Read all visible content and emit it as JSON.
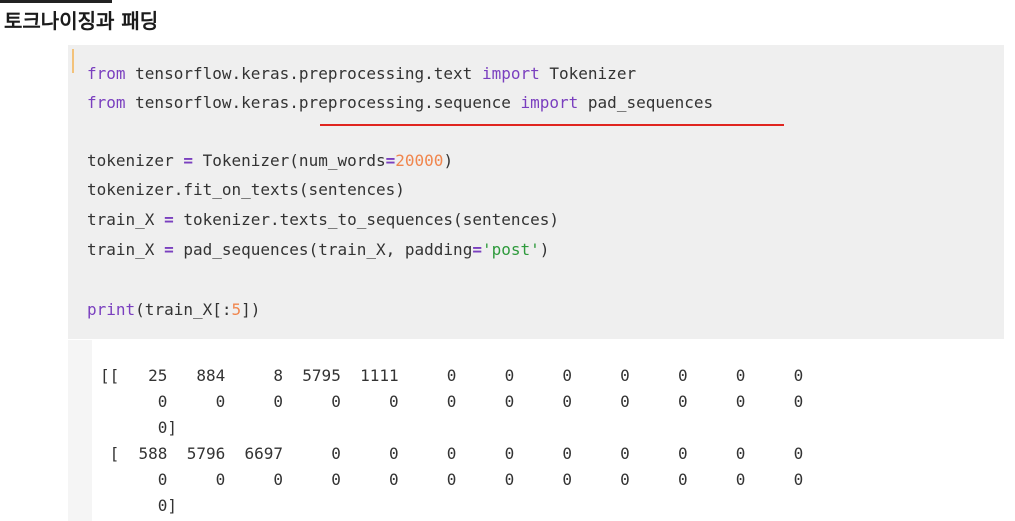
{
  "heading": "토크나이징과 패딩",
  "code": {
    "line1": {
      "kw1": "from",
      "mod": " tensorflow.keras.preprocessing.text ",
      "kw2": "import",
      "name": " Tokenizer"
    },
    "line2": {
      "kw1": "from",
      "mod": " tensorflow.keras.preprocessing.sequence ",
      "kw2": "import",
      "name": " pad_sequences"
    },
    "line3": {
      "a": "tokenizer ",
      "eq": "=",
      "b": " Tokenizer(num_words",
      "eq2": "=",
      "num": "20000",
      "c": ")"
    },
    "line4": "tokenizer.fit_on_texts(sentences)",
    "line5": {
      "a": "train_X ",
      "eq": "=",
      "b": " tokenizer.texts_to_sequences(sentences)"
    },
    "line6": {
      "a": "train_X ",
      "eq": "=",
      "b": " pad_sequences(train_X, padding",
      "eq2": "=",
      "str": "'post'",
      "c": ")"
    },
    "line7": {
      "kw": "print",
      "a": "(train_X[:",
      "num": "5",
      "b": "])"
    }
  },
  "output": {
    "lines": [
      "[[   25   884     8  5795  1111     0     0     0     0     0     0     0",
      "      0     0     0     0     0     0     0     0     0     0     0     0",
      "      0]",
      " [  588  5796  6697     0     0     0     0     0     0     0     0     0",
      "      0     0     0     0     0     0     0     0     0     0     0     0",
      "      0]"
    ]
  },
  "colors": {
    "keyword": "#7a3fbf",
    "number": "#f0864e",
    "string": "#2e9a3c",
    "underline": "#e0251f",
    "code_background": "#efefef"
  }
}
